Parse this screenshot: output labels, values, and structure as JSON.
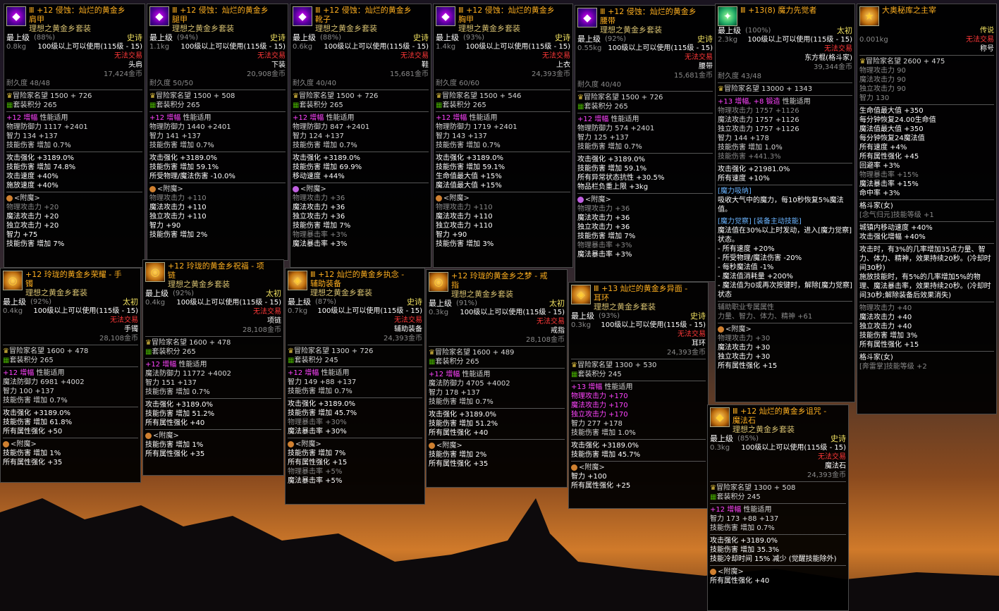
{
  "page": {
    "background": "#1a1420"
  },
  "panels": {
    "p1": {
      "icon": "purple",
      "title1": "Ⅲ +12 侵蚀：灿烂的黄金乡",
      "title2": "肩甲",
      "set": "理想之黄金乡套装",
      "grade": "最上级",
      "pct": "(88%)",
      "rarity": "史诗",
      "weight": "0.8kg",
      "req": "100级以上可以使用(115级 - 15)",
      "notrade": "无法交易",
      "slot": "头肩",
      "price": "17,424金币",
      "dur": "耐久度 48/48",
      "fame": "冒险家名望 1500 + 726",
      "setpts": "套装积分 265",
      "amp": "+12 增幅",
      "perf": "性能适用",
      "stats": [
        "物理防御力 1117 +2401",
        "智力 134 +137",
        "技能伤害 增加 0.7%"
      ],
      "stats2": [
        "攻击强化 +3189.0%",
        "技能伤害 增加 74.8%",
        "攻击速度 +40%",
        "施放速度 +40%"
      ],
      "ench": "<附魔>",
      "ench_lines": [
        "物理攻击力 +20",
        "魔法攻击力 +20",
        "独立攻击力 +20",
        "智力 +75",
        "技能伤害 增加 7%"
      ]
    },
    "p2": {
      "icon": "purple",
      "title1": "Ⅲ +12 侵蚀：灿烂的黄金乡",
      "title2": "腿甲",
      "set": "理想之黄金乡套装",
      "grade": "最上级",
      "pct": "(94%)",
      "rarity": "史诗",
      "weight": "1.1kg",
      "req": "100级以上可以使用(115级 - 15)",
      "notrade": "无法交易",
      "slot": "下装",
      "price": "20,908金币",
      "dur": "耐久度 50/50",
      "fame": "冒险家名望 1500 + 508",
      "setpts": "套装积分 265",
      "amp": "+12 增幅",
      "perf": "性能适用",
      "stats": [
        "物理防御力 1440 +2401",
        "智力 141 +137",
        "技能伤害 增加 0.7%"
      ],
      "stats2": [
        "攻击强化 +3189.0%",
        "技能伤害 增加 59.1%",
        "所受物理/魔法伤害 -10.0%"
      ],
      "ench": "<附魔>",
      "ench_lines": [
        "物理攻击力 +110",
        "魔法攻击力 +110",
        "独立攻击力 +110",
        "智力 +90",
        "技能伤害 增加 2%"
      ]
    },
    "p3": {
      "icon": "purple",
      "title1": "Ⅲ +12 侵蚀：灿烂的黄金乡",
      "title2": "靴子",
      "set": "理想之黄金乡套装",
      "grade": "最上级",
      "pct": "(88%)",
      "rarity": "史诗",
      "weight": "0.6kg",
      "req": "100级以上可以使用(115级 - 15)",
      "notrade": "无法交易",
      "slot": "鞋",
      "price": "15,681金币",
      "dur": "耐久度 40/40",
      "fame": "冒险家名望 1500 + 726",
      "setpts": "套装积分 265",
      "amp": "+12 增幅",
      "perf": "性能适用",
      "stats": [
        "物理防御力 847 +2401",
        "智力 124 +137",
        "技能伤害 增加 0.7%"
      ],
      "stats2": [
        "攻击强化 +3189.0%",
        "技能伤害 增加 69.9%",
        "移动速度 +44%"
      ],
      "ench": "<附魔>",
      "ench_lines": [
        "物理攻击力 +36",
        "魔法攻击力 +36",
        "独立攻击力 +36",
        "技能伤害 增加 7%",
        "物理暴击率 +3%",
        "魔法暴击率 +3%"
      ]
    },
    "p4": {
      "icon": "purple",
      "title1": "Ⅲ +12 侵蚀：灿烂的黄金乡",
      "title2": "胸甲",
      "set": "理想之黄金乡套装",
      "grade": "最上级",
      "pct": "(93%)",
      "rarity": "史诗",
      "weight": "1.4kg",
      "req": "100级以上可以使用(115级 - 15)",
      "notrade": "无法交易",
      "slot": "上衣",
      "price": "24,393金币",
      "dur": "耐久度 60/60",
      "fame": "冒险家名望 1500 + 546",
      "setpts": "套装积分 265",
      "amp": "+12 增幅",
      "perf": "性能适用",
      "stats": [
        "物理防御力 1719 +2401",
        "智力 143 +137",
        "技能伤害 增加 0.7%"
      ],
      "stats2": [
        "攻击强化 +3189.0%",
        "技能伤害 增加 59.1%",
        "生命值最大值 +15%",
        "魔法值最大值 +15%"
      ],
      "ench": "<附魔>",
      "ench_lines": [
        "物理攻击力 +110",
        "魔法攻击力 +110",
        "独立攻击力 +110",
        "智力 +90",
        "技能伤害 增加 3%"
      ]
    },
    "p5": {
      "icon": "purple",
      "title1": "Ⅲ +12 侵蚀：灿烂的黄金乡",
      "title2": "腰带",
      "set": "理想之黄金乡套装",
      "grade": "最上级",
      "pct": "(92%)",
      "rarity": "史诗",
      "weight": "0.55kg",
      "req": "100级以上可以使用(115级 - 15)",
      "notrade": "无法交易",
      "slot": "腰带",
      "price": "15,681金币",
      "dur": "耐久度 40/40",
      "fame": "冒险家名望 1500 + 726",
      "setpts": "套装积分 265",
      "amp": "+12 增幅",
      "perf": "性能适用",
      "stats": [
        "物理防御力 574 +2401",
        "智力 125 +137",
        "技能伤害 增加 0.7%"
      ],
      "stats2": [
        "攻击强化 +3189.0%",
        "技能伤害 增加 59.1%",
        "所有异常状态抗性 +30.5%",
        "物品栏负重上限 +3kg"
      ],
      "ench": "<附魔>",
      "ench_lines": [
        "物理攻击力 +36",
        "魔法攻击力 +36",
        "独立攻击力 +36",
        "技能伤害 增加 7%",
        "物理暴击率 +3%",
        "魔法暴击率 +3%"
      ]
    },
    "p6": {
      "icon": "green",
      "title1": "Ⅲ +13(8) 魔力先觉者",
      "grade": "最上级",
      "pct": "(100%)",
      "rarity": "太初",
      "weight": "2.3kg",
      "req": "100级以上可以使用(115级 - 15)",
      "notrade": "无法交易",
      "slot": "东方棍(格斗家)",
      "price": "39,344金币",
      "dur": "耐久度 43/48",
      "fame": "冒险家名望 13000 + 1343",
      "amp": "+13 增幅, +8 锻造",
      "perf": "性能适用",
      "stats": [
        "物理攻击力 1757 +1126",
        "魔法攻击力 1757 +1126",
        "独立攻击力 1757 +1126",
        "智力 144 +178",
        "技能伤害 增加 1.0%",
        "技能伤害 +441.3%"
      ],
      "stats2": [
        "攻击强化 +21981.0%",
        "所有速度 +10%"
      ],
      "sk1": "[魔力吸纳]",
      "sk1d": "吸收大气中的魔力，每10秒恢复5%魔法值。",
      "sk2": "[魔力觉察] [装备主动技能]",
      "sk2d": [
        "魔法值在30%以上时发动，进入[魔力觉察]状态。",
        "- 所有速度 +20%",
        "- 所受物理/魔法伤害 -20%",
        "- 每秒魔法值 -1%",
        "- 魔法值消耗量 +200%",
        "- 魔法值为0或再次按键时，解除[魔力觉察]状态"
      ],
      "aux": "辅助职业专属属性",
      "auxd": "力量、智力、体力、精神 +61",
      "ench": "<附魔>",
      "ench_lines": [
        "物理攻击力 +30",
        "魔法攻击力 +30",
        "独立攻击力 +30",
        "所有属性强化 +15"
      ]
    },
    "p7": {
      "icon": "gold",
      "title1": "大奥秘库之主宰",
      "rarity": "传说",
      "weight": "0.001kg",
      "notrade": "无法交易",
      "slot": "称号",
      "fame": "冒险家名望 2600 + 475",
      "stats": [
        "物理攻击力 90",
        "魔法攻击力 90",
        "独立攻击力 90",
        "智力 130"
      ],
      "stats2": [
        "生命值最大值 +350",
        "每分钟恢复24.00生命值",
        "魔法值最大值 +350",
        "每分钟恢复24魔法值",
        "所有速度 +4%",
        "所有属性强化 +45",
        "回避率 +3%",
        "物理暴击率 +15%",
        "魔法暴击率 +15%",
        "命中率 +3%"
      ],
      "job1": "格斗家(女)",
      "job1s": "[念气归元]技能等级 +1",
      "town": "城镇内移动速度 +40%",
      "atkamp": "攻击强化增幅 +40%",
      "proc": [
        "攻击时，有3%的几率增加35点力量、智力、体力、精神，效果持续20秒。(冷却时间30秒)",
        "施放技能时，有5%的几率增加5%的物理、魔法暴击率，效果持续20秒。(冷却时间30秒;解除装备后效果消失)"
      ],
      "ench_lines": [
        "物理攻击力 +40",
        "魔法攻击力 +40",
        "独立攻击力 +40",
        "技能伤害 增加 3%",
        "所有属性强化 +15"
      ],
      "job2": "格斗家(女)",
      "job2s": "[奔雷掌]技能等级 +2"
    },
    "p8": {
      "icon": "gold",
      "title1": "+12 玲珑的黄金乡荣耀 - 手",
      "title2": "镯",
      "set": "理想之黄金乡套装",
      "grade": "最上级",
      "pct": "(92%)",
      "rarity": "太初",
      "weight": "0.4kg",
      "req": "100级以上可以使用(115级 - 15)",
      "notrade": "无法交易",
      "slot": "手镯",
      "price": "28,108金币",
      "fame": "冒险家名望 1600 + 478",
      "setpts": "套装积分 265",
      "amp": "+12 增幅",
      "perf": "性能适用",
      "stats": [
        "魔法防御力 6981 +4002",
        "智力 100 +137",
        "技能伤害 增加 0.7%"
      ],
      "stats2": [
        "攻击强化 +3189.0%",
        "技能伤害 增加 61.8%",
        "所有属性强化 +50"
      ],
      "ench": "<附魔>",
      "ench_lines": [
        "技能伤害 增加 1%",
        "所有属性强化 +35"
      ]
    },
    "p9": {
      "icon": "gold",
      "title1": "+12 玲珑的黄金乡祝福 - 项",
      "title2": "链",
      "set": "理想之黄金乡套装",
      "grade": "最上级",
      "pct": "(92%)",
      "rarity": "太初",
      "weight": "0.4kg",
      "req": "100级以上可以使用(115级 - 15)",
      "notrade": "无法交易",
      "slot": "项链",
      "price": "28,108金币",
      "fame": "冒险家名望 1600 + 478",
      "setpts": "套装积分 265",
      "amp": "+12 增幅",
      "perf": "性能适用",
      "stats": [
        "魔法防御力 11772 +4002",
        "智力 151 +137",
        "技能伤害 增加 0.7%"
      ],
      "stats2": [
        "攻击强化 +3189.0%",
        "技能伤害 增加 51.2%",
        "所有属性强化 +40"
      ],
      "ench": "<附魔>",
      "ench_lines": [
        "技能伤害 增加 1%",
        "所有属性强化 +35"
      ]
    },
    "p10": {
      "icon": "gold",
      "title1": "Ⅲ +12 灿烂的黄金乡执念 -",
      "title2": "辅助装备",
      "set": "理想之黄金乡套装",
      "grade": "最上级",
      "pct": "(87%)",
      "rarity": "史诗",
      "weight": "0.7kg",
      "req": "100级以上可以使用(115级 - 15)",
      "notrade": "无法交易",
      "slot": "辅助装备",
      "price": "24,393金币",
      "fame": "冒险家名望 1300 + 726",
      "setpts": "套装积分 245",
      "amp": "+12 增幅",
      "perf": "性能适用",
      "stats": [
        "智力 149 +88 +137",
        "技能伤害 增加 0.7%"
      ],
      "stats2": [
        "攻击强化 +3189.0%",
        "技能伤害 增加 45.7%",
        "物理暴击率 +30%",
        "魔法暴击率 +30%"
      ],
      "ench": "<附魔>",
      "ench_lines": [
        "技能伤害 增加 7%",
        "所有属性强化 +15",
        "物理暴击率 +5%",
        "魔法暴击率 +5%"
      ]
    },
    "p11": {
      "icon": "gold",
      "title1": "+12 玲珑的黄金乡之梦 - 戒",
      "title2": "指",
      "set": "理想之黄金乡套装",
      "grade": "最上级",
      "pct": "(91%)",
      "rarity": "太初",
      "weight": "0.3kg",
      "req": "100级以上可以使用(115级 - 15)",
      "notrade": "无法交易",
      "slot": "戒指",
      "price": "28,108金币",
      "fame": "冒险家名望 1600 + 489",
      "setpts": "套装积分 265",
      "amp": "+12 增幅",
      "perf": "性能适用",
      "stats": [
        "魔法防御力 4705 +4002",
        "智力 178 +137",
        "技能伤害 增加 0.7%"
      ],
      "stats2": [
        "攻击强化 +3189.0%",
        "技能伤害 增加 51.2%",
        "所有属性强化 +40"
      ],
      "ench": "<附魔>",
      "ench_lines": [
        "技能伤害 增加 2%",
        "所有属性强化 +35"
      ]
    },
    "p12": {
      "icon": "gold",
      "title1": "Ⅲ +13 灿烂的黄金乡异面 -",
      "title2": "耳环",
      "set": "理想之黄金乡套装",
      "grade": "最上级",
      "pct": "(93%)",
      "rarity": "史诗",
      "weight": "0.3kg",
      "req": "100级以上可以使用(115级 - 15)",
      "notrade": "无法交易",
      "slot": "耳环",
      "price": "24,393金币",
      "fame": "冒险家名望 1300 + 530",
      "setpts": "套装积分 245",
      "amp": "+13 增幅",
      "perf": "性能适用",
      "stats": [
        "物理攻击力 +170",
        "魔法攻击力 +170",
        "独立攻击力 +170",
        "智力 277 +178",
        "技能伤害 增加 1.0%"
      ],
      "stats2": [
        "攻击强化 +3189.0%",
        "技能伤害 增加 45.7%"
      ],
      "ench": "<附魔>",
      "ench_lines": [
        "智力 +100",
        "所有属性强化 +25"
      ]
    },
    "p13": {
      "icon": "gold",
      "title1": "Ⅲ +12 灿烂的黄金乡诅咒 -",
      "title2": "魔法石",
      "set": "理想之黄金乡套装",
      "grade": "最上级",
      "pct": "(85%)",
      "rarity": "史诗",
      "weight": "0.3kg",
      "req": "100级以上可以使用(115级 - 15)",
      "notrade": "无法交易",
      "slot": "魔法石",
      "price": "24,393金币",
      "fame": "冒险家名望 1300 + 508",
      "setpts": "套装积分 245",
      "amp": "+12 增幅",
      "perf": "性能适用",
      "stats": [
        "智力 173 +88 +137",
        "技能伤害 增加 0.7%"
      ],
      "stats2": [
        "攻击强化 +3189.0%",
        "技能伤害 增加 35.3%",
        "技能冷却时间 15% 减少 (觉醒技能除外)"
      ],
      "ench": "<附魔>",
      "ench_lines": [
        "所有属性强化 +40"
      ]
    }
  }
}
